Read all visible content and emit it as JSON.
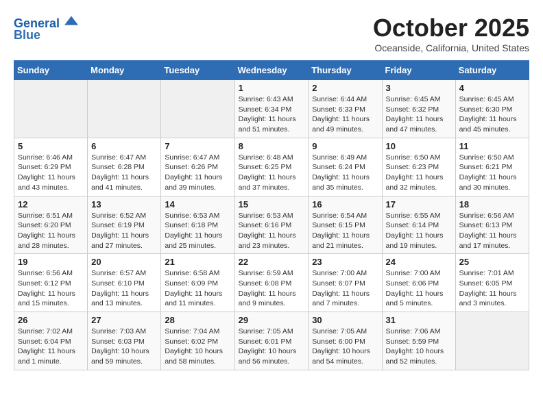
{
  "header": {
    "logo_line1": "General",
    "logo_line2": "Blue",
    "month": "October 2025",
    "location": "Oceanside, California, United States"
  },
  "weekdays": [
    "Sunday",
    "Monday",
    "Tuesday",
    "Wednesday",
    "Thursday",
    "Friday",
    "Saturday"
  ],
  "weeks": [
    [
      {
        "num": "",
        "detail": ""
      },
      {
        "num": "",
        "detail": ""
      },
      {
        "num": "",
        "detail": ""
      },
      {
        "num": "1",
        "detail": "Sunrise: 6:43 AM\nSunset: 6:34 PM\nDaylight: 11 hours\nand 51 minutes."
      },
      {
        "num": "2",
        "detail": "Sunrise: 6:44 AM\nSunset: 6:33 PM\nDaylight: 11 hours\nand 49 minutes."
      },
      {
        "num": "3",
        "detail": "Sunrise: 6:45 AM\nSunset: 6:32 PM\nDaylight: 11 hours\nand 47 minutes."
      },
      {
        "num": "4",
        "detail": "Sunrise: 6:45 AM\nSunset: 6:30 PM\nDaylight: 11 hours\nand 45 minutes."
      }
    ],
    [
      {
        "num": "5",
        "detail": "Sunrise: 6:46 AM\nSunset: 6:29 PM\nDaylight: 11 hours\nand 43 minutes."
      },
      {
        "num": "6",
        "detail": "Sunrise: 6:47 AM\nSunset: 6:28 PM\nDaylight: 11 hours\nand 41 minutes."
      },
      {
        "num": "7",
        "detail": "Sunrise: 6:47 AM\nSunset: 6:26 PM\nDaylight: 11 hours\nand 39 minutes."
      },
      {
        "num": "8",
        "detail": "Sunrise: 6:48 AM\nSunset: 6:25 PM\nDaylight: 11 hours\nand 37 minutes."
      },
      {
        "num": "9",
        "detail": "Sunrise: 6:49 AM\nSunset: 6:24 PM\nDaylight: 11 hours\nand 35 minutes."
      },
      {
        "num": "10",
        "detail": "Sunrise: 6:50 AM\nSunset: 6:23 PM\nDaylight: 11 hours\nand 32 minutes."
      },
      {
        "num": "11",
        "detail": "Sunrise: 6:50 AM\nSunset: 6:21 PM\nDaylight: 11 hours\nand 30 minutes."
      }
    ],
    [
      {
        "num": "12",
        "detail": "Sunrise: 6:51 AM\nSunset: 6:20 PM\nDaylight: 11 hours\nand 28 minutes."
      },
      {
        "num": "13",
        "detail": "Sunrise: 6:52 AM\nSunset: 6:19 PM\nDaylight: 11 hours\nand 27 minutes."
      },
      {
        "num": "14",
        "detail": "Sunrise: 6:53 AM\nSunset: 6:18 PM\nDaylight: 11 hours\nand 25 minutes."
      },
      {
        "num": "15",
        "detail": "Sunrise: 6:53 AM\nSunset: 6:16 PM\nDaylight: 11 hours\nand 23 minutes."
      },
      {
        "num": "16",
        "detail": "Sunrise: 6:54 AM\nSunset: 6:15 PM\nDaylight: 11 hours\nand 21 minutes."
      },
      {
        "num": "17",
        "detail": "Sunrise: 6:55 AM\nSunset: 6:14 PM\nDaylight: 11 hours\nand 19 minutes."
      },
      {
        "num": "18",
        "detail": "Sunrise: 6:56 AM\nSunset: 6:13 PM\nDaylight: 11 hours\nand 17 minutes."
      }
    ],
    [
      {
        "num": "19",
        "detail": "Sunrise: 6:56 AM\nSunset: 6:12 PM\nDaylight: 11 hours\nand 15 minutes."
      },
      {
        "num": "20",
        "detail": "Sunrise: 6:57 AM\nSunset: 6:10 PM\nDaylight: 11 hours\nand 13 minutes."
      },
      {
        "num": "21",
        "detail": "Sunrise: 6:58 AM\nSunset: 6:09 PM\nDaylight: 11 hours\nand 11 minutes."
      },
      {
        "num": "22",
        "detail": "Sunrise: 6:59 AM\nSunset: 6:08 PM\nDaylight: 11 hours\nand 9 minutes."
      },
      {
        "num": "23",
        "detail": "Sunrise: 7:00 AM\nSunset: 6:07 PM\nDaylight: 11 hours\nand 7 minutes."
      },
      {
        "num": "24",
        "detail": "Sunrise: 7:00 AM\nSunset: 6:06 PM\nDaylight: 11 hours\nand 5 minutes."
      },
      {
        "num": "25",
        "detail": "Sunrise: 7:01 AM\nSunset: 6:05 PM\nDaylight: 11 hours\nand 3 minutes."
      }
    ],
    [
      {
        "num": "26",
        "detail": "Sunrise: 7:02 AM\nSunset: 6:04 PM\nDaylight: 11 hours\nand 1 minute."
      },
      {
        "num": "27",
        "detail": "Sunrise: 7:03 AM\nSunset: 6:03 PM\nDaylight: 10 hours\nand 59 minutes."
      },
      {
        "num": "28",
        "detail": "Sunrise: 7:04 AM\nSunset: 6:02 PM\nDaylight: 10 hours\nand 58 minutes."
      },
      {
        "num": "29",
        "detail": "Sunrise: 7:05 AM\nSunset: 6:01 PM\nDaylight: 10 hours\nand 56 minutes."
      },
      {
        "num": "30",
        "detail": "Sunrise: 7:05 AM\nSunset: 6:00 PM\nDaylight: 10 hours\nand 54 minutes."
      },
      {
        "num": "31",
        "detail": "Sunrise: 7:06 AM\nSunset: 5:59 PM\nDaylight: 10 hours\nand 52 minutes."
      },
      {
        "num": "",
        "detail": ""
      }
    ]
  ]
}
